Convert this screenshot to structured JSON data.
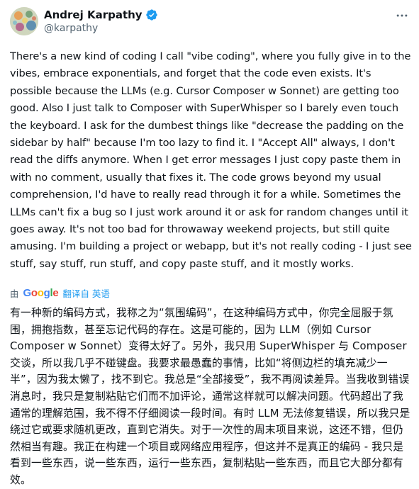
{
  "author": {
    "name": "Andrej Karpathy",
    "handle": "@karpathy",
    "verified_color": "#1d9bf0"
  },
  "icons": {
    "avatar": "avatar-image",
    "verified": "verified-badge-icon",
    "more": "more-options-icon"
  },
  "tweet": {
    "text": "There's a new kind of coding I call \"vibe coding\", where you fully give in to the vibes, embrace exponentials, and forget that the code even exists. It's possible because the LLMs (e.g. Cursor Composer w Sonnet) are getting too good. Also I just talk to Composer with SuperWhisper so I barely even touch the keyboard. I ask for the dumbest things like \"decrease the padding on the sidebar by half\" because I'm too lazy to find it. I \"Accept All\" always, I don't read the diffs anymore. When I get error messages I just copy paste them in with no comment, usually that fixes it. The code grows beyond my usual comprehension, I'd have to really read through it for a while. Sometimes the LLMs can't fix a bug so I just work around it or ask for random changes until it goes away. It's not too bad for throwaway weekend projects, but still quite amusing. I'm building a project or webapp, but it's not really coding - I just see stuff, say stuff, run stuff, and copy paste stuff, and it mostly works."
  },
  "translation": {
    "by_label": "由",
    "provider": "Google",
    "link_label": "翻译自 英语",
    "text": "有一种新的编码方式，我称之为“氛围编码”，在这种编码方式中，你完全屈服于氛围，拥抱指数，甚至忘记代码的存在。这是可能的，因为 LLM（例如 Cursor Composer w Sonnet）变得太好了。另外，我只用 SuperWhisper 与 Composer 交谈，所以我几乎不碰键盘。我要求最愚蠢的事情，比如“将侧边栏的填充减少一半”，因为我太懒了，找不到它。我总是“全部接受”，我不再阅读差异。当我收到错误消息时，我只是复制粘贴它们而不加评论，通常这样就可以解决问题。代码超出了我通常的理解范围，我不得不仔细阅读一段时间。有时 LLM 无法修复错误，所以我只是绕过它或要求随机更改，直到它消失。对于一次性的周末项目来说，这还不错，但仍然相当有趣。我正在构建一个项目或网络应用程序，但这并不是真正的编码 - 我只是看到一些东西，说一些东西，运行一些东西，复制粘贴一些东西，而且它大部分都有效。"
  }
}
